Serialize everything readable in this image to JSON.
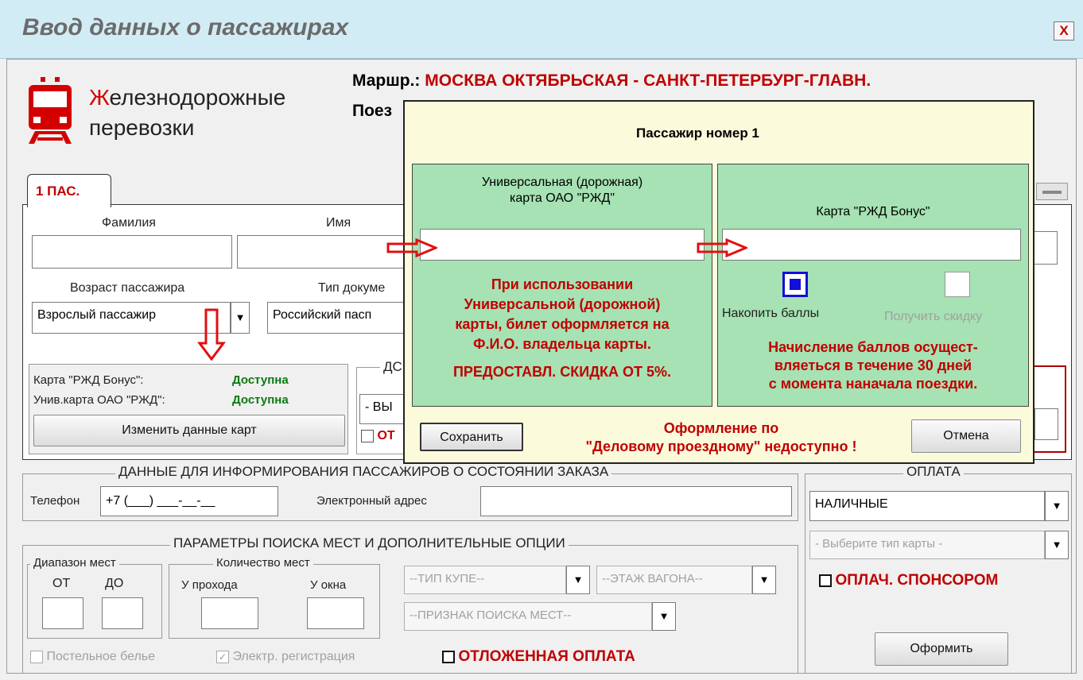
{
  "window": {
    "title": "Ввод данных о пассажирах",
    "close_label": "X"
  },
  "logo": {
    "line1_first": "Ж",
    "line1_rest": "елезнодорожные",
    "line2": "перевозки"
  },
  "route": {
    "label": "Маршр.:",
    "value": "МОСКВА ОКТЯБРЬСКАЯ - САНКТ-ПЕТЕРБУРГ-ГЛАВН.",
    "train_label": "Поез"
  },
  "tab": {
    "label": "1 ПАС."
  },
  "passenger_form": {
    "surname_label": "Фамилия",
    "name_label": "Имя",
    "age_label": "Возраст пассажира",
    "age_value": "Взрослый пассажир",
    "doc_type_label": "Тип докуме",
    "doc_type_value": "Российский пасп",
    "cards": {
      "bonus_label": "Карта \"РЖД Бонус\":",
      "bonus_status": "Доступна",
      "univ_label": "Унив.карта ОАО \"РЖД\":",
      "univ_status": "Доступна",
      "change_button": "Изменить данные карт"
    },
    "doc_group_partial": "ДС",
    "select_partial": "- ВЫ",
    "checkbox_partial": "ОТ"
  },
  "contact": {
    "group_title": "ДАННЫЕ ДЛЯ ИНФОРМИРОВАНИЯ ПАССАЖИРОВ О СОСТОЯНИИ ЗАКАЗА",
    "phone_label": "Телефон",
    "phone_value": "+7 (___) ___-__-__",
    "email_label": "Электронный адрес"
  },
  "search_params": {
    "group_title": "ПАРАМЕТРЫ ПОИСКА МЕСТ И ДОПОЛНИТЕЛЬНЫЕ ОПЦИИ",
    "range_title": "Диапазон мест",
    "from_label": "ОТ",
    "to_label": "ДО",
    "count_title": "Количество мест",
    "aisle_label": "У прохода",
    "window_label": "У окна",
    "compartment_type": "--ТИП КУПЕ--",
    "car_floor": "--ЭТАЖ ВАГОНА--",
    "seat_search": "--ПРИЗНАК ПОИСКА МЕСТ--",
    "bedding_label": "Постельное белье",
    "e_registration_label": "Электр. регистрация",
    "deferred_payment_label": "ОТЛОЖЕННАЯ ОПЛАТА"
  },
  "payment": {
    "group_title": "ОПЛАТА",
    "method_value": "НАЛИЧНЫЕ",
    "card_type_placeholder": "- Выберите тип карты -",
    "sponsor_label": "ОПЛАЧ. СПОНСОРОМ",
    "submit_button": "Оформить"
  },
  "popup": {
    "title": "Пассажир номер 1",
    "left_panel": {
      "title_line1": "Универсальная (дорожная)",
      "title_line2": "карта ОАО \"РЖД\"",
      "warning_lines": [
        "При использовании",
        "Универсальной (дорожной)",
        "карты, билет оформляется на",
        "Ф.И.О. владельца карты."
      ],
      "discount": "ПРЕДОСТАВЛ. СКИДКА ОТ 5%."
    },
    "right_panel": {
      "title": "Карта \"РЖД Бонус\"",
      "accumulate_label": "Накопить баллы",
      "discount_label": "Получить скидку",
      "note_lines": [
        "Начисление баллов осущест-",
        "вляеться в течение 30 дней",
        "с момента наначала поездки."
      ]
    },
    "save_button": "Сохранить",
    "cancel_button": "Отмена",
    "business_line1": "Оформление по",
    "business_line2": "\"Деловому проездному\" недоступно !"
  },
  "colors": {
    "accent_red": "#c00000",
    "status_green": "#0c7a12",
    "popup_panel": "#a6e2b3",
    "titlebar": "#d2ecf5"
  },
  "icons": [
    "train-icon",
    "close-icon",
    "arrow-right-icon",
    "arrow-down-icon",
    "dropdown-arrow-icon"
  ]
}
